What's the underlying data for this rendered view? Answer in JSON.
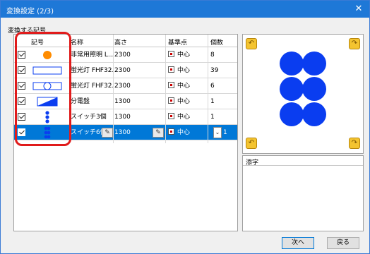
{
  "window": {
    "title": "変換設定 (2/3)",
    "close_glyph": "✕"
  },
  "section_label": "変換する記号",
  "columns": [
    "記号",
    "名称",
    "高さ",
    "基準点",
    "個数"
  ],
  "rows": [
    {
      "symbol": "orange-circle",
      "name": "非常用照明 L...",
      "height": "2300",
      "base": "中心",
      "count": "8"
    },
    {
      "symbol": "rectangle",
      "name": "蛍光灯 FHF32...",
      "height": "2300",
      "base": "中心",
      "count": "39"
    },
    {
      "symbol": "rectangle-with-circle",
      "name": "蛍光灯 FHF32...",
      "height": "2300",
      "base": "中心",
      "count": "6"
    },
    {
      "symbol": "diagonal-panel",
      "name": "分電盤",
      "height": "1300",
      "base": "中心",
      "count": "1"
    },
    {
      "symbol": "three-dots",
      "name": "スイッチ3個",
      "height": "1300",
      "base": "中心",
      "count": "1"
    },
    {
      "symbol": "six-dots",
      "name": "スイッチ6個",
      "height": "1300",
      "base": "中心",
      "count": "1"
    }
  ],
  "suffix_header": "添字",
  "buttons": {
    "next": "次へ",
    "back": "戻る"
  },
  "colors": {
    "titlebar": "#1e78d7",
    "selection": "#0078d7",
    "symbol_blue": "#0a3df0",
    "symbol_orange": "#ff8c00",
    "highlight": "#e01b1b"
  }
}
